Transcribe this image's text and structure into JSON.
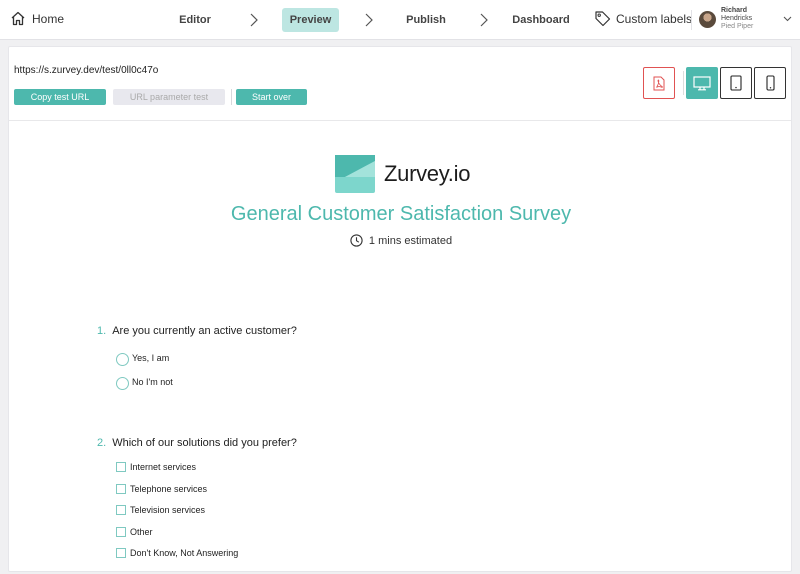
{
  "nav": {
    "home_label": "Home",
    "steps": [
      {
        "label": "Editor"
      },
      {
        "label": "Preview"
      },
      {
        "label": "Publish"
      },
      {
        "label": "Dashboard"
      }
    ],
    "active_step": "Preview",
    "custom_labels": "Custom labels",
    "user": {
      "first": "Richard",
      "last": "Hendricks",
      "org": "Pied Piper"
    }
  },
  "toolbar": {
    "url": "https://s.zurvey.dev/test/0ll0c47o",
    "copy_label": "Copy test URL",
    "param_label": "URL parameter test",
    "start_label": "Start over"
  },
  "devices": [
    "pdf-icon",
    "desktop-icon",
    "tablet-icon",
    "phone-icon"
  ],
  "survey": {
    "logo_text": "Zurvey.io",
    "title": "General Customer Satisfaction Survey",
    "estimate": "1 mins estimated",
    "questions": [
      {
        "number": "1.",
        "text": "Are you currently an active customer?",
        "type": "radio",
        "options": [
          "Yes, I am",
          "No I'm not"
        ]
      },
      {
        "number": "2.",
        "text": "Which of our solutions did you prefer?",
        "type": "checkbox",
        "options": [
          "Internet services",
          "Telephone services",
          "Television services",
          "Other",
          "Don't Know, Not Answering"
        ]
      }
    ]
  },
  "colors": {
    "accent": "#4db8ad",
    "accent_light": "#bde6e2",
    "pdf": "#e05252"
  }
}
